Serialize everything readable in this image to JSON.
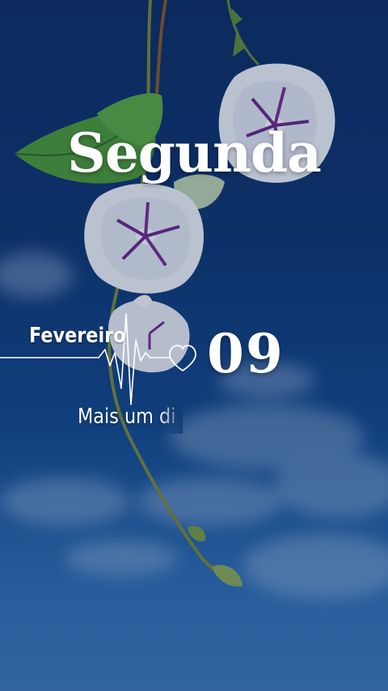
{
  "weekday": "Segunda",
  "month": "Fevereiro",
  "day": "09",
  "tagline": "Mais um di",
  "icons": {
    "heart": "heart-icon",
    "pulse": "heartbeat-line-icon"
  },
  "colors": {
    "sky": "#134a8f",
    "text": "#ffffff",
    "petal": "#eef1f8",
    "petal_accent": "#6a2a8a",
    "leaf": "#4e9a3a"
  }
}
